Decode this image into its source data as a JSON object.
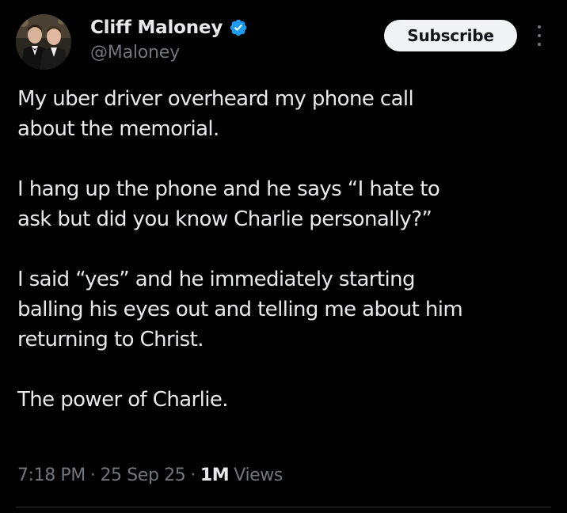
{
  "author": {
    "display_name": "Cliff Maloney",
    "handle": "@Maloney",
    "verified": true,
    "verified_color": "#1d9bf0"
  },
  "actions": {
    "subscribe_label": "Subscribe"
  },
  "post": {
    "paragraphs": [
      "My uber driver overheard my phone call\nabout the memorial.",
      "I hang up the phone and he says “I hate to\nask but did you know Charlie personally?”",
      "I said “yes” and he immediately starting\nballing his eyes out and telling me about him\nreturning to Christ.",
      "The power of Charlie."
    ]
  },
  "meta": {
    "time": "7:18 PM",
    "date": "25 Sep 25",
    "separator": "·",
    "views_count": "1M",
    "views_label": "Views"
  },
  "theme": {
    "background": "#000000",
    "text_primary": "#e7e9ea",
    "text_secondary": "#71767b",
    "button_bg": "#eff3f4"
  },
  "icons": {
    "verified": "verified-badge-icon",
    "more": "more-vertical-icon"
  }
}
